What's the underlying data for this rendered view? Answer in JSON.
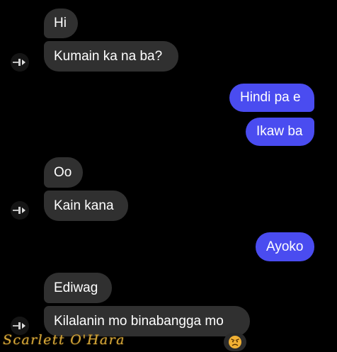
{
  "conversation": {
    "messages": [
      {
        "sender": "other",
        "text": "Hi"
      },
      {
        "sender": "other",
        "text": "Kumain ka na ba?"
      },
      {
        "sender": "me",
        "text": "Hindi pa e"
      },
      {
        "sender": "me",
        "text": "Ikaw ba"
      },
      {
        "sender": "other",
        "text": "Oo"
      },
      {
        "sender": "other",
        "text": "Kain kana"
      },
      {
        "sender": "me",
        "text": "Ayoko"
      },
      {
        "sender": "other",
        "text": "Ediwag"
      },
      {
        "sender": "other",
        "text": "Kilalanin mo binabangga mo"
      }
    ],
    "reaction": {
      "icon": "angry-face-emoji",
      "on_message": 8
    }
  },
  "watermark": {
    "text": "Scarlett O'Hara"
  },
  "colors": {
    "background": "#000000",
    "incoming_bubble": "#303030",
    "outgoing_bubble": "#4a4cf0",
    "text": "#ffffff",
    "watermark": "#d7a93a"
  }
}
